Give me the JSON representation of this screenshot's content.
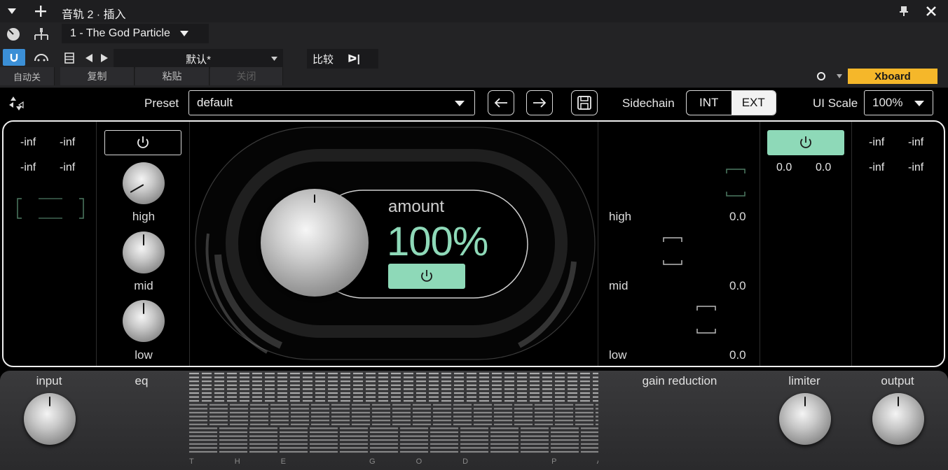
{
  "window": {
    "title": "音轨 2 · 插入",
    "track_name": "1 - The God Particle",
    "preset_host": "默认*",
    "compare_label": "比较",
    "copy_label": "复制",
    "paste_label": "粘贴",
    "automation_label": "自动关",
    "bypass_label": "关闭",
    "channel_label": "Xboard",
    "accent_blue": "#3b8fd6",
    "accent_yellow": "#f5b72a"
  },
  "plugin": {
    "preset_label": "Preset",
    "preset_value": "default",
    "sidechain_label": "Sidechain",
    "sidechain_options": [
      "INT",
      "EXT"
    ],
    "sidechain_selected": "EXT",
    "ui_scale_label": "UI Scale",
    "ui_scale_value": "100%",
    "accent_mint": "#8ed9b8"
  },
  "input_meter": {
    "l_peak": "-inf",
    "r_peak": "-inf",
    "l_rms": "-inf",
    "r_rms": "-inf"
  },
  "eq": {
    "high_label": "high",
    "mid_label": "mid",
    "low_label": "low"
  },
  "amount": {
    "label": "amount",
    "value": "100%"
  },
  "gain_reduction": {
    "high_label": "high",
    "high_value": "0.0",
    "mid_label": "mid",
    "mid_value": "0.0",
    "low_label": "low",
    "low_value": "0.0"
  },
  "limiter": {
    "left_value": "0.0",
    "right_value": "0.0"
  },
  "output_meter": {
    "l_peak": "-inf",
    "r_peak": "-inf",
    "l_rms": "-inf",
    "r_rms": "-inf"
  },
  "bottom": {
    "input_label": "input",
    "eq_label": "eq",
    "gain_reduction_label": "gain reduction",
    "limiter_label": "limiter",
    "output_label": "output",
    "footer_text": "THE GOD PARTICLE"
  }
}
